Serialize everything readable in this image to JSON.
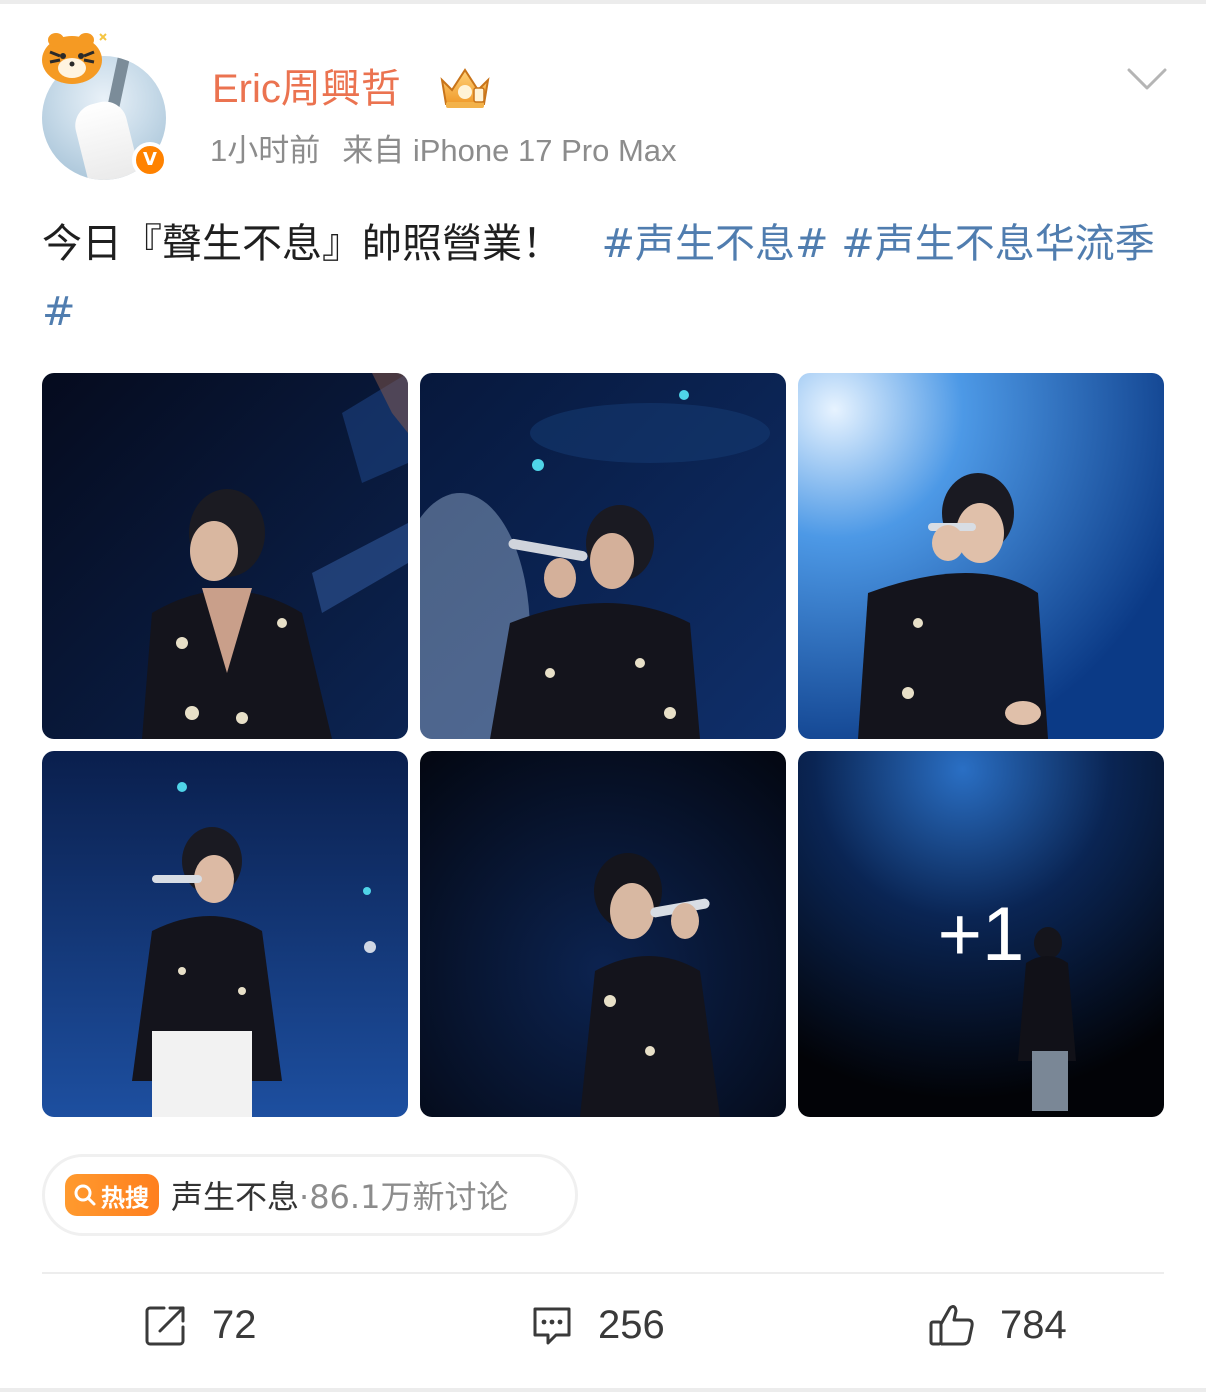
{
  "post": {
    "username": "Eric周興哲",
    "time": "1小时前",
    "source": "来自 iPhone 17 Pro Max",
    "text_plain": "今日『聲生不息』帥照營業！",
    "hashtag_1": "#声生不息#",
    "hashtag_2": "#声生不息华流季#",
    "more_photos_label": "+1"
  },
  "hot_search": {
    "badge": "热搜",
    "topic": "声生不息",
    "separator": "·",
    "count": "86.1万新讨论"
  },
  "actions": {
    "repost_count": "72",
    "comment_count": "256",
    "like_count": "784"
  },
  "icons": {
    "menu": "chevron-down-icon",
    "verified": "verified-v-icon",
    "crown": "crown-badge-icon",
    "search": "search-icon",
    "repost": "repost-icon",
    "comment": "comment-icon",
    "like": "thumbs-up-icon"
  },
  "colors": {
    "username": "#eb7350",
    "hashtag": "#507daf",
    "verified": "#ff8200",
    "hot_badge": "#ff8c26",
    "meta_text": "#8c8c8c"
  }
}
